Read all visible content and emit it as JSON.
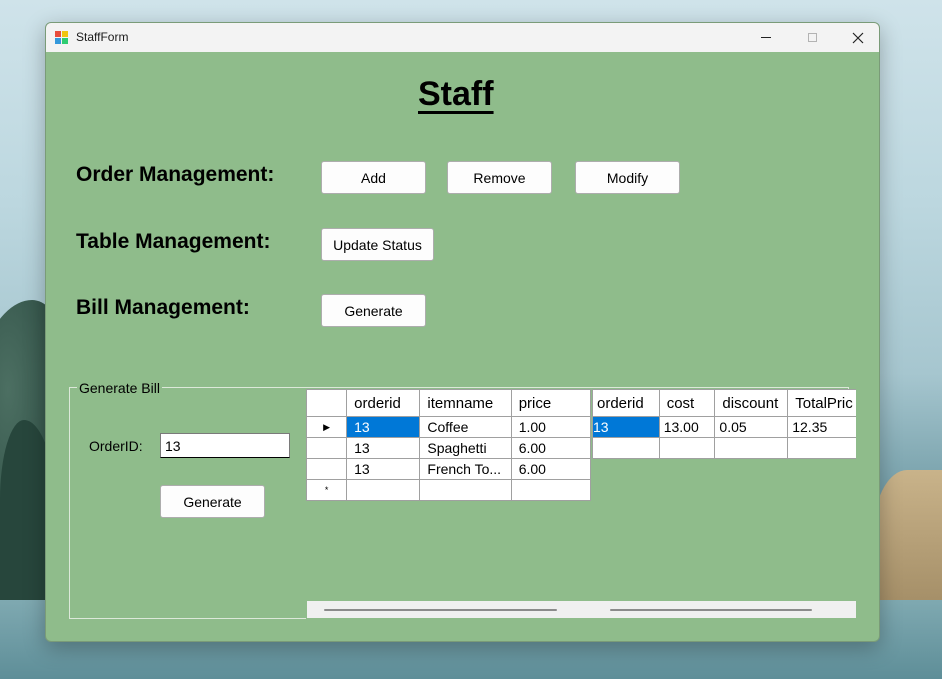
{
  "window": {
    "title": "StaffForm"
  },
  "heading": "Staff",
  "sections": {
    "order": {
      "label": "Order Management:",
      "buttons": [
        "Add",
        "Remove",
        "Modify"
      ]
    },
    "table": {
      "label": "Table Management:",
      "button": "Update Status"
    },
    "bill": {
      "label": "Bill Management:",
      "button": "Generate"
    }
  },
  "generate_bill": {
    "title": "Generate Bill",
    "orderid_label": "OrderID:",
    "orderid_value": "13",
    "button": "Generate"
  },
  "items_grid": {
    "columns": [
      "orderid",
      "itemname",
      "price"
    ],
    "rows": [
      [
        "13",
        "Coffee",
        "1.00"
      ],
      [
        "13",
        "Spaghetti",
        "6.00"
      ],
      [
        "13",
        "French To...",
        "6.00"
      ]
    ],
    "current_row_marker": "▶",
    "new_row_marker": "*"
  },
  "bill_grid": {
    "columns": [
      "orderid",
      "cost",
      "discount",
      "TotalPric"
    ],
    "rows": [
      [
        "13",
        "13.00",
        "0.05",
        "12.35"
      ]
    ]
  },
  "colors": {
    "form_background": "#8fbc8b",
    "selection": "#0078d7"
  }
}
